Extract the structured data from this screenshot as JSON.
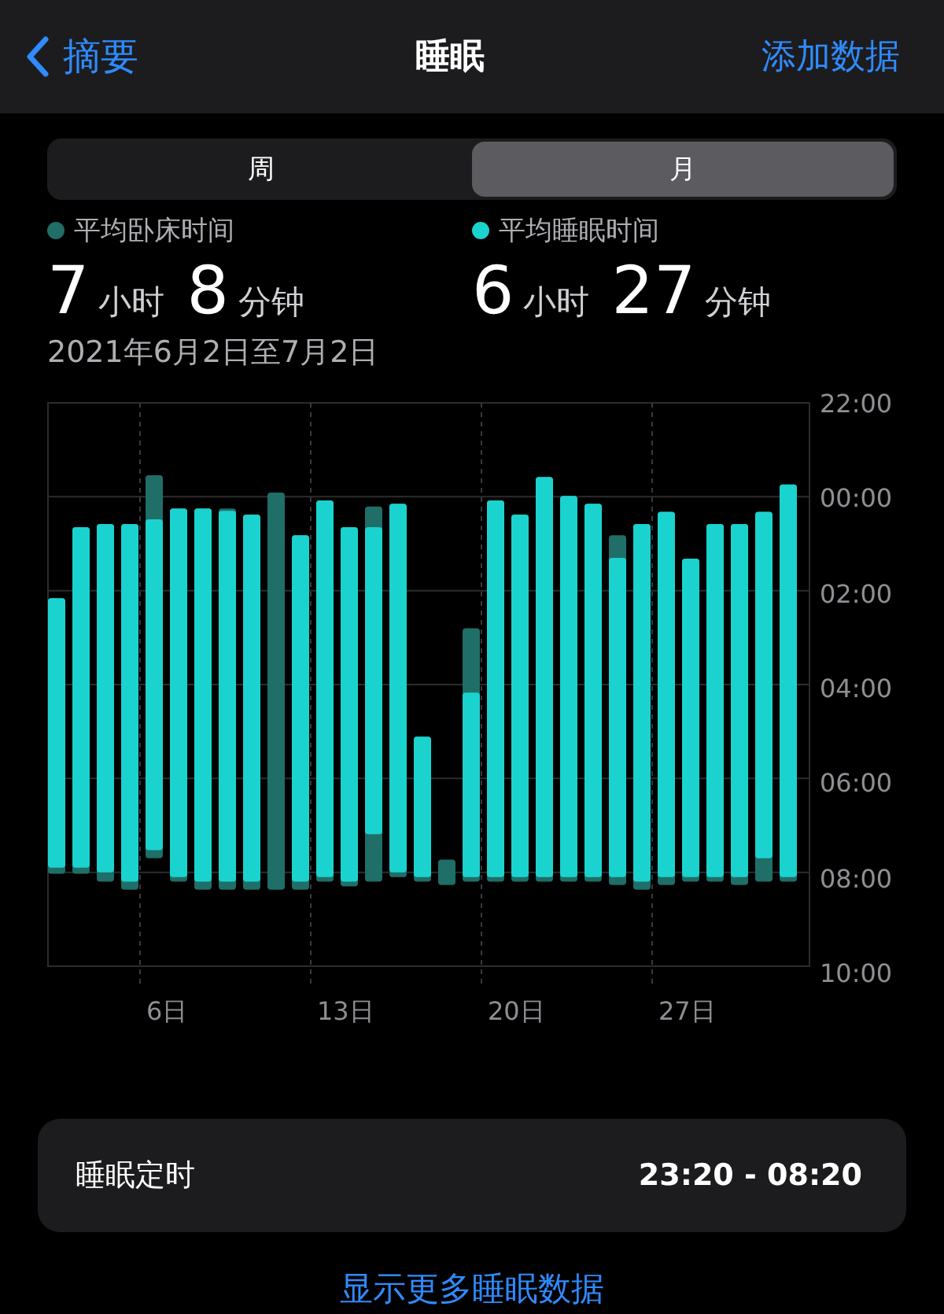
{
  "nav": {
    "back": "摘要",
    "title": "睡眠",
    "action": "添加数据"
  },
  "segments": [
    {
      "label": "周",
      "selected": false
    },
    {
      "label": "月",
      "selected": true
    }
  ],
  "stats": [
    {
      "label": "平均卧床时间",
      "color": "#1f6e67",
      "hours": "7",
      "hours_unit": "小时",
      "minutes": "8",
      "minutes_unit": "分钟"
    },
    {
      "label": "平均睡眠时间",
      "color": "#1ad3cf",
      "hours": "6",
      "hours_unit": "小时",
      "minutes": "27",
      "minutes_unit": "分钟"
    }
  ],
  "date_range": "2021年6月2日至7月2日",
  "chart": {
    "y_labels": [
      "22:00",
      "00:00",
      "02:00",
      "04:00",
      "06:00",
      "08:00",
      "10:00"
    ],
    "x_labels": [
      "6日",
      "13日",
      "20日",
      "27日"
    ]
  },
  "schedule": {
    "label": "睡眠定时",
    "value": "23:20 - 08:20"
  },
  "more_link": "显示更多睡眠数据"
}
